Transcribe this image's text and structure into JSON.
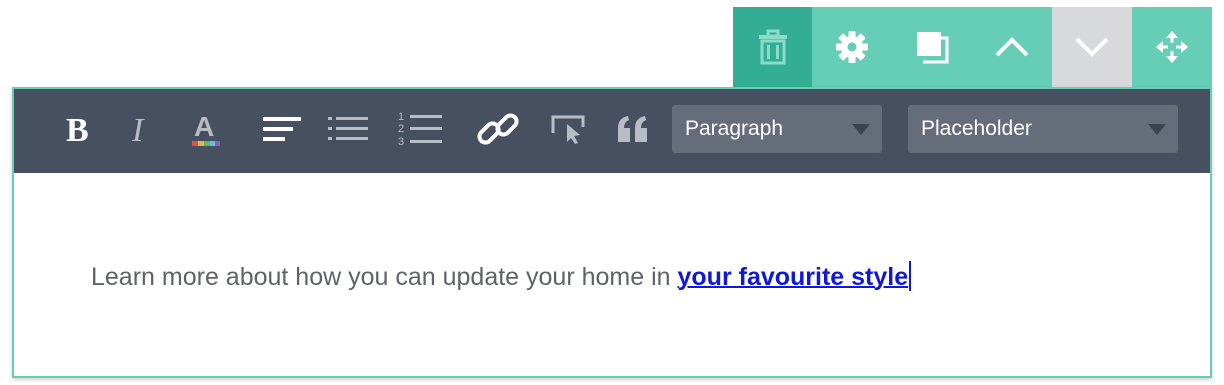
{
  "action_bar": {
    "buttons": [
      {
        "name": "delete",
        "icon": "trash-icon"
      },
      {
        "name": "settings",
        "icon": "gear-icon"
      },
      {
        "name": "clone",
        "icon": "clone-icon"
      },
      {
        "name": "move-up",
        "icon": "chevron-up-icon"
      },
      {
        "name": "move-down",
        "icon": "chevron-down-icon"
      },
      {
        "name": "drag",
        "icon": "move-arrows-icon"
      }
    ],
    "colors": {
      "primary": "#66cdb6",
      "active": "#33ae95",
      "disabled": "#d7d9db"
    }
  },
  "toolbar": {
    "buttons": [
      {
        "name": "bold",
        "icon": "bold-icon"
      },
      {
        "name": "italic",
        "icon": "italic-icon"
      },
      {
        "name": "text-color",
        "icon": "text-color-icon"
      },
      {
        "name": "align",
        "icon": "align-left-icon"
      },
      {
        "name": "bullet-list",
        "icon": "bullet-list-icon"
      },
      {
        "name": "numbered-list",
        "icon": "numbered-list-icon"
      },
      {
        "name": "link",
        "icon": "link-icon"
      },
      {
        "name": "select-element",
        "icon": "cursor-select-icon"
      },
      {
        "name": "blockquote",
        "icon": "quote-icon"
      }
    ],
    "format_select": {
      "value": "Paragraph"
    },
    "placeholder_select": {
      "value": "Placeholder"
    },
    "background": "#475061"
  },
  "content": {
    "text": "Learn more about how you can update your home in ",
    "link_text": "your favourite style",
    "link_color": "#0f17d8"
  }
}
